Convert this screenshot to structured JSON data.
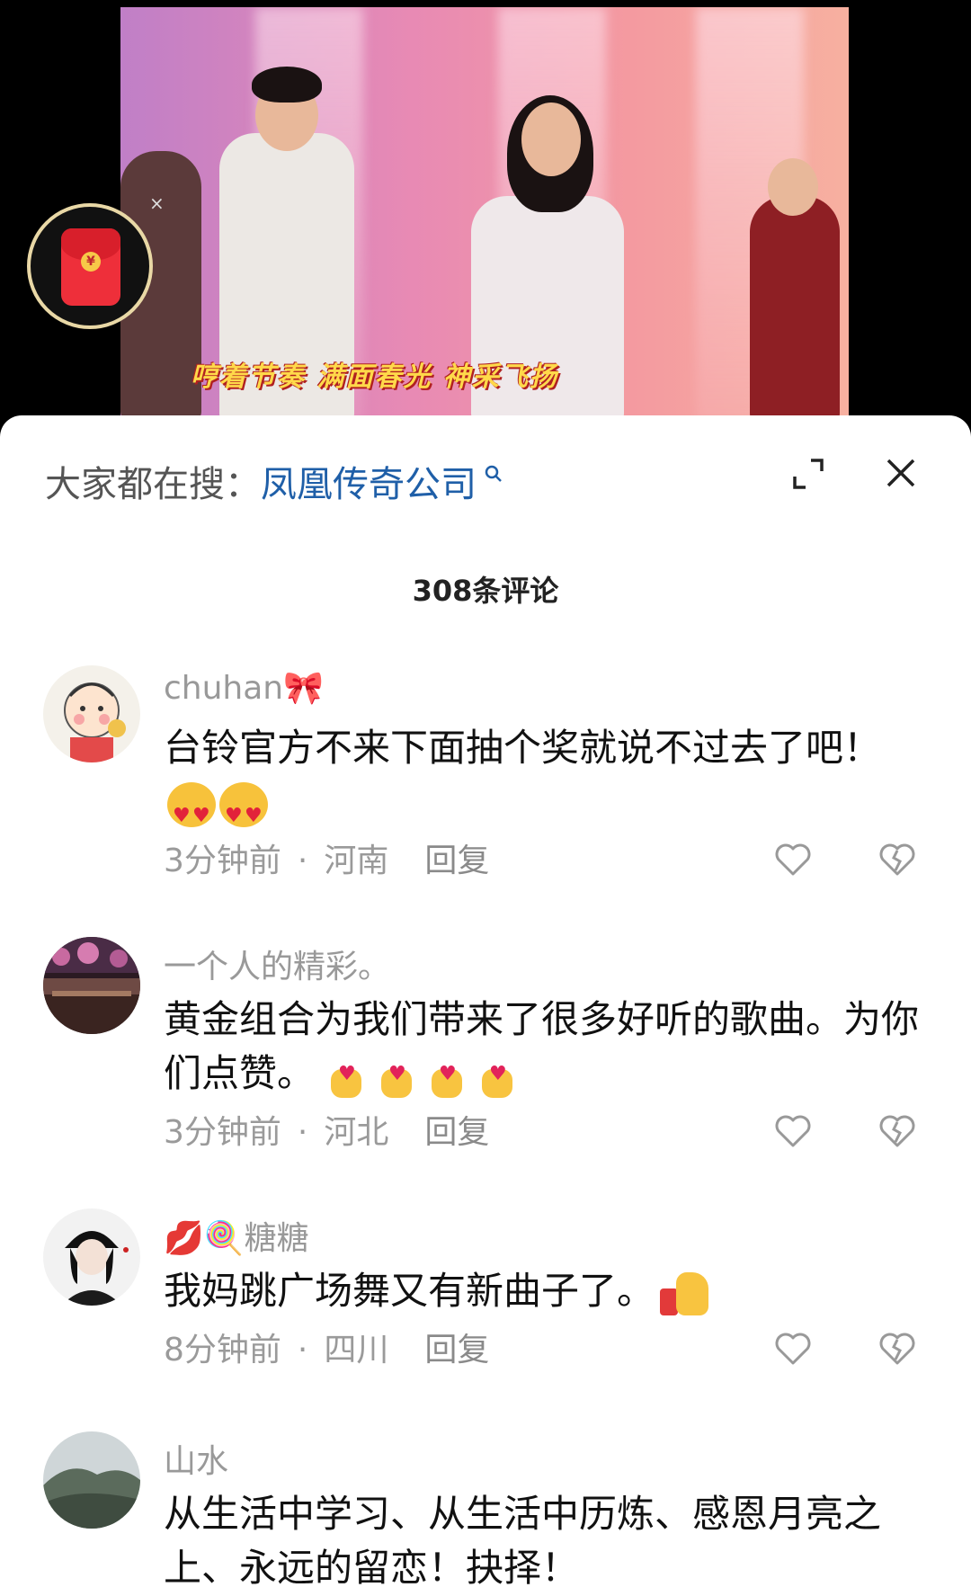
{
  "video": {
    "subtitle": "哼着节奏 满面春光 神采飞扬",
    "red_packet_symbol": "¥",
    "red_packet_close": "×"
  },
  "search": {
    "prefix": "大家都在搜：",
    "term": "凤凰传奇公司",
    "magnifier": "ᴽ"
  },
  "comments_header": {
    "count_label": "308条评论"
  },
  "comments": [
    {
      "username": "chuhan🎀",
      "text": "台铃官方不来下面抽个奖就说不过去了吧！",
      "time": "3分钟前",
      "location": "河南",
      "reply": "回复",
      "avatar": "cartoon-avatar"
    },
    {
      "username": "一个人的精彩。",
      "text": "黄金组合为我们带来了很多好听的歌曲。为你们点赞。",
      "time": "3分钟前",
      "location": "河北",
      "reply": "回复",
      "avatar": "night-scene-avatar"
    },
    {
      "username": "💋🍭糖糖",
      "text": "我妈跳广场舞又有新曲子了。",
      "time": "8分钟前",
      "location": "四川",
      "reply": "回复",
      "avatar": "woman-cap-avatar"
    },
    {
      "username": "山水",
      "text": "从生活中学习、从生活中历炼、感恩月亮之上、永远的留恋！抉择！",
      "avatar": "mountain-avatar"
    }
  ],
  "colors": {
    "accent_link": "#1f5fa8",
    "meta_gray": "#9a9a9a",
    "red_packet": "#ee2f3a"
  }
}
